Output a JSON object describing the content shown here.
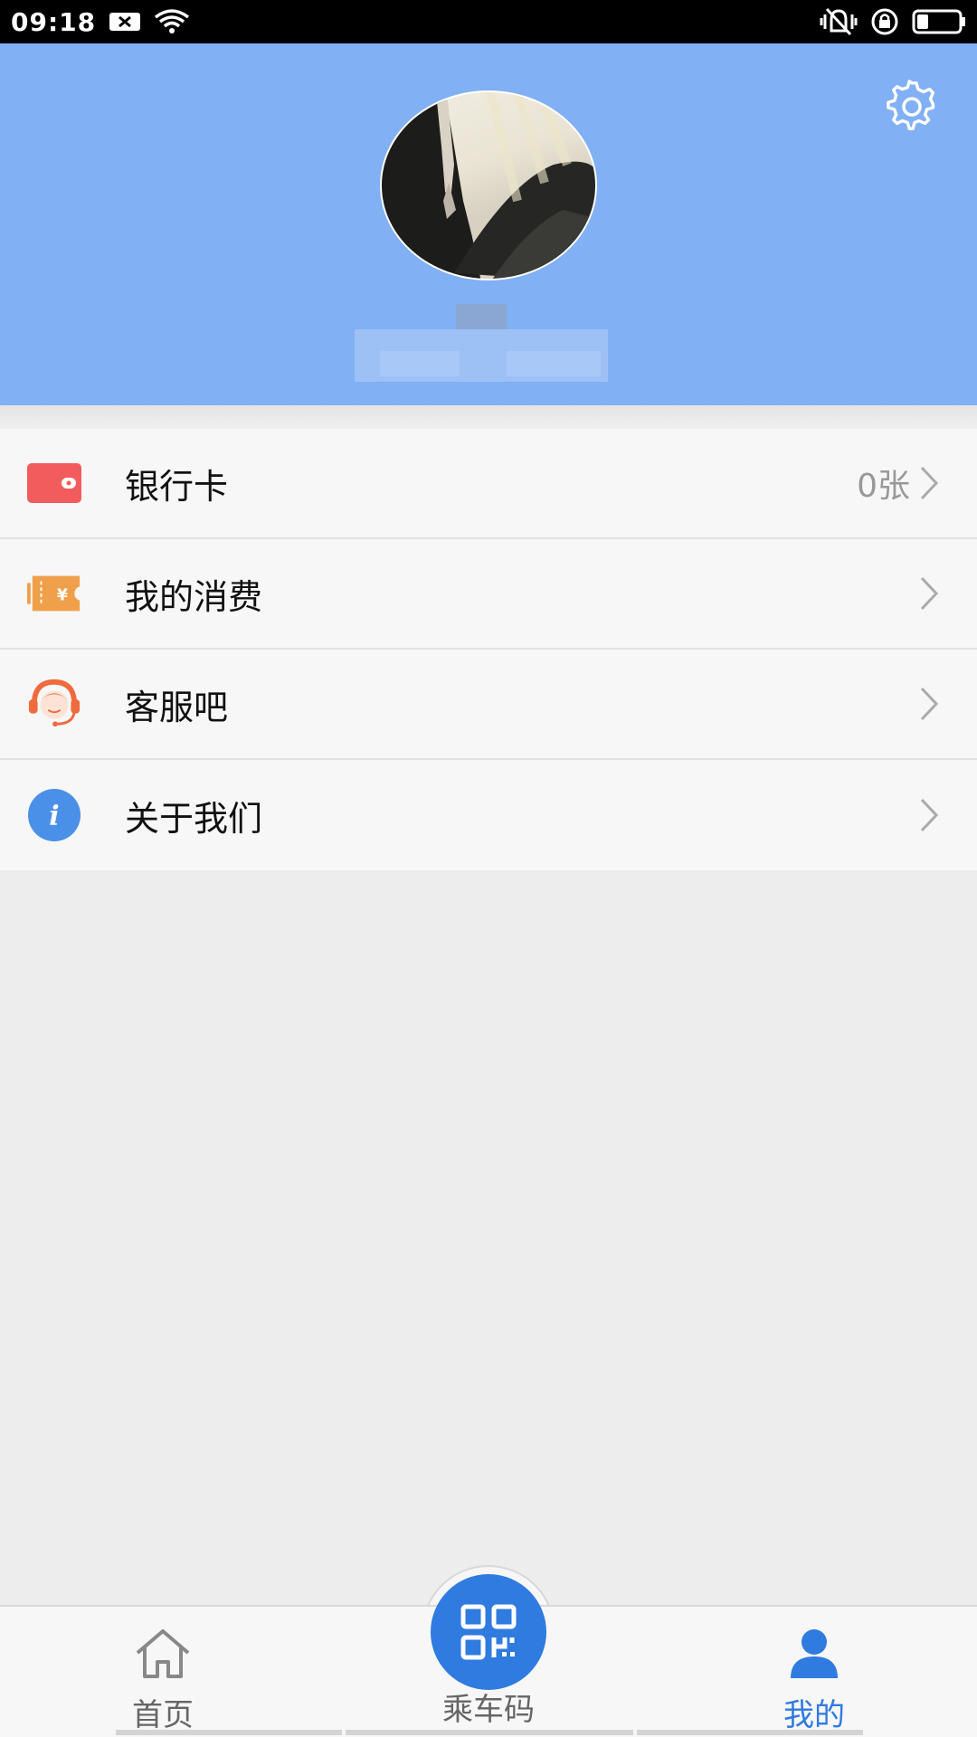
{
  "status_bar": {
    "time": "09:18",
    "icons": [
      "notification-x-icon",
      "wifi-icon",
      "vibrate-icon",
      "rotation-lock-icon",
      "battery-icon"
    ]
  },
  "header": {
    "background_color": "#81b0f4",
    "settings_icon": "gear-icon",
    "avatar_alt": "avatar"
  },
  "menu": {
    "items": [
      {
        "label": "银行卡",
        "extra": "0张",
        "icon": "wallet-icon",
        "icon_color": "#f25c5c"
      },
      {
        "label": "我的消费",
        "extra": "",
        "icon": "ticket-icon",
        "icon_color": "#f0a04b"
      },
      {
        "label": "客服吧",
        "extra": "",
        "icon": "customer-service-icon",
        "icon_color": "#f06a3c"
      },
      {
        "label": "关于我们",
        "extra": "",
        "icon": "info-icon",
        "icon_color": "#4a90e8"
      }
    ]
  },
  "bottom_nav": {
    "home_label": "首页",
    "ride_label": "乘车码",
    "me_label": "我的",
    "active_color": "#2f7be0"
  }
}
